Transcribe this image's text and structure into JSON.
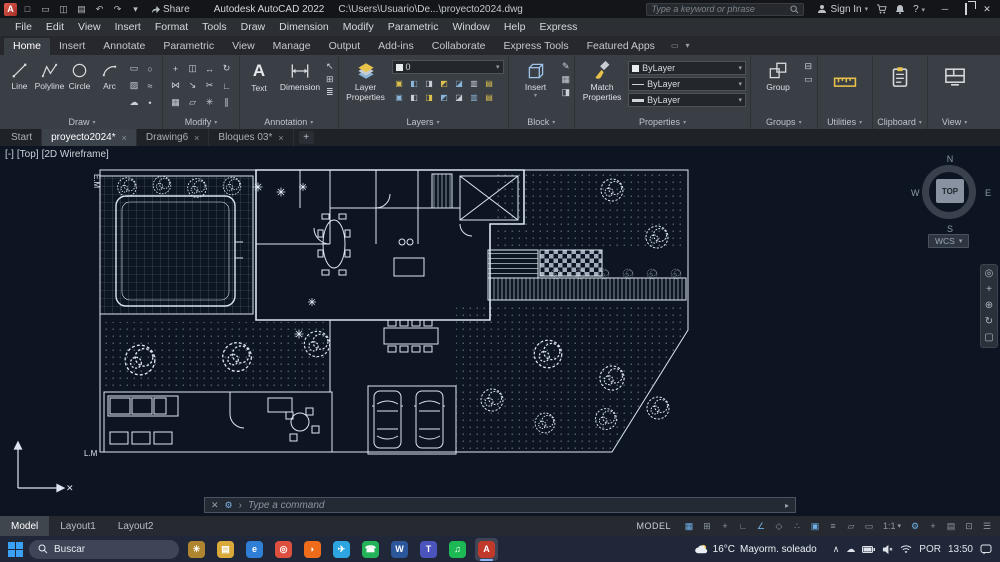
{
  "icons": {
    "caret_down": "▾",
    "minimize": "─",
    "close": "✕",
    "close_small": "×",
    "prompt_arrow": "›",
    "scroll_right": "▸",
    "chevron_up": "∧",
    "cloud": "☁",
    "dock_wrench": "⚙",
    "dock_close": "✕"
  },
  "titlebar": {
    "logo_letter": "A",
    "quick_icons": [
      {
        "name": "new-drawing-icon",
        "glyph": "□"
      },
      {
        "name": "open-icon",
        "glyph": "▭"
      },
      {
        "name": "save-icon",
        "glyph": "◫"
      },
      {
        "name": "plot-icon",
        "glyph": "▤"
      },
      {
        "name": "undo-icon",
        "glyph": "↶"
      },
      {
        "name": "redo-icon",
        "glyph": "↷"
      },
      {
        "name": "quick-access-caret-icon",
        "glyph": "▾"
      }
    ],
    "share_label": "Share",
    "app_title": "Autodesk AutoCAD 2022",
    "doc_path": "C:\\Users\\Usuario\\De...\\proyecto2024.dwg",
    "search_placeholder": "Type a keyword or phrase",
    "sign_in_label": "Sign In",
    "help_label": "?"
  },
  "menubar": {
    "items": [
      "File",
      "Edit",
      "View",
      "Insert",
      "Format",
      "Tools",
      "Draw",
      "Dimension",
      "Modify",
      "Parametric",
      "Window",
      "Help",
      "Express"
    ]
  },
  "ribbon": {
    "tabs": [
      {
        "label": "Home",
        "active": true
      },
      {
        "label": "Insert"
      },
      {
        "label": "Annotate"
      },
      {
        "label": "Parametric"
      },
      {
        "label": "View"
      },
      {
        "label": "Manage"
      },
      {
        "label": "Output"
      },
      {
        "label": "Add-ins"
      },
      {
        "label": "Collaborate"
      },
      {
        "label": "Express Tools"
      },
      {
        "label": "Featured Apps"
      }
    ],
    "draw": {
      "label": "Draw",
      "tools": [
        {
          "name": "line-tool",
          "label": "Line"
        },
        {
          "name": "polyline-tool",
          "label": "Polyline"
        },
        {
          "name": "circle-tool",
          "label": "Circle"
        },
        {
          "name": "arc-tool",
          "label": "Arc"
        }
      ],
      "minis": [
        {
          "name": "rectangle-tool-icon",
          "glyph": "▭"
        },
        {
          "name": "ellipse-tool-icon",
          "glyph": "○"
        },
        {
          "name": "hatch-tool-icon",
          "glyph": "▨"
        },
        {
          "name": "spline-tool-icon",
          "glyph": "≈"
        },
        {
          "name": "revision-cloud-tool-icon",
          "glyph": "☁"
        },
        {
          "name": "point-tool-icon",
          "glyph": "•"
        }
      ]
    },
    "modify": {
      "label": "Modify",
      "tools": [
        {
          "name": "move-tool-icon",
          "glyph": "+"
        },
        {
          "name": "copy-tool-icon",
          "glyph": "◫"
        },
        {
          "name": "stretch-tool-icon",
          "glyph": "↔"
        },
        {
          "name": "rotate-tool-icon",
          "glyph": "↻"
        },
        {
          "name": "mirror-tool-icon",
          "glyph": "⋈"
        },
        {
          "name": "scale-tool-icon",
          "glyph": "↘"
        },
        {
          "name": "trim-tool-icon",
          "glyph": "✂"
        },
        {
          "name": "fillet-tool-icon",
          "glyph": "∟"
        },
        {
          "name": "array-tool-icon",
          "glyph": "▦"
        },
        {
          "name": "erase-tool-icon",
          "glyph": "▱"
        },
        {
          "name": "explode-tool-icon",
          "glyph": "✳"
        },
        {
          "name": "offset-tool-icon",
          "glyph": "∥"
        }
      ]
    },
    "annotation": {
      "label": "Annotation",
      "text_label": "Text",
      "dim_label": "Dimension",
      "minis": [
        {
          "name": "leader-tool-icon",
          "glyph": "↖"
        },
        {
          "name": "table-tool-icon",
          "glyph": "⊞"
        },
        {
          "name": "mtext-tool-icon",
          "glyph": "≣"
        }
      ]
    },
    "layers": {
      "label": "Layers",
      "big_line1": "Layer",
      "big_line2": "Properties",
      "combo_value": "0",
      "minis": [
        {
          "name": "layer-state-icon",
          "glyph": "▣",
          "color": "#dcc24d"
        },
        {
          "name": "layer-isolate-icon",
          "glyph": "◧",
          "color": "#8ab4d8"
        },
        {
          "name": "layer-freeze-icon",
          "glyph": "◨",
          "color": "#c8cdd3"
        },
        {
          "name": "layer-lock-icon",
          "glyph": "◩",
          "color": "#dcc24d"
        },
        {
          "name": "layer-off-icon",
          "glyph": "◪",
          "color": "#8ab4d8"
        },
        {
          "name": "layer-match-icon",
          "glyph": "▥",
          "color": "#c8cdd3"
        },
        {
          "name": "layer-prev-icon",
          "glyph": "▤",
          "color": "#dcc24d"
        },
        {
          "name": "layer-walk-icon",
          "glyph": "▣",
          "color": "#8ab4d8"
        },
        {
          "name": "layer-thaw-icon",
          "glyph": "◧",
          "color": "#c8cdd3"
        },
        {
          "name": "layer-on-icon",
          "glyph": "◨",
          "color": "#dcc24d"
        },
        {
          "name": "layer-merge-icon",
          "glyph": "◩",
          "color": "#8ab4d8"
        },
        {
          "name": "layer-delete-icon",
          "glyph": "◪",
          "color": "#c8cdd3"
        },
        {
          "name": "layer-unlock-icon",
          "glyph": "▥",
          "color": "#8ab4d8"
        },
        {
          "name": "layer-current-icon",
          "glyph": "▤",
          "color": "#dcc24d"
        }
      ]
    },
    "block": {
      "label": "Block",
      "big_label": "Insert",
      "minis": [
        {
          "name": "create-block-icon",
          "glyph": "✎"
        },
        {
          "name": "edit-block-icon",
          "glyph": "▦"
        },
        {
          "name": "block-attributes-icon",
          "glyph": "◨"
        }
      ]
    },
    "properties": {
      "label": "Properties",
      "big_line1": "Match",
      "big_line2": "Properties",
      "combos": [
        {
          "name": "object-color-combo",
          "value": "ByLayer",
          "kind": "swatch"
        },
        {
          "name": "linetype-combo",
          "value": "ByLayer",
          "kind": "line"
        },
        {
          "name": "lineweight-combo",
          "value": "ByLayer",
          "kind": "thick"
        }
      ]
    },
    "groups": {
      "label": "Groups",
      "big_label": "Group",
      "minis": [
        {
          "name": "ungroup-icon",
          "glyph": "⊟"
        },
        {
          "name": "group-edit-icon",
          "glyph": "▭"
        }
      ]
    },
    "utilities": {
      "label": "Utilities"
    },
    "clipboard": {
      "label": "Clipboard"
    },
    "view_panel": {
      "label": "View"
    }
  },
  "filetabs": {
    "tabs": [
      {
        "label": "Start"
      },
      {
        "label": "proyecto2024*",
        "active": true,
        "closable": true
      },
      {
        "label": "Drawing6",
        "closable": true
      },
      {
        "label": "Bloques 03*",
        "closable": true
      }
    ],
    "new_tab_label": "+"
  },
  "viewport": {
    "control_min": "[-]",
    "control_view": "[Top]",
    "control_visual": "[2D Wireframe]",
    "em_label": "E.M",
    "lm_label": "L.M",
    "viewcube": {
      "north": "N",
      "west": "W",
      "south": "S",
      "east": "E",
      "top": "TOP",
      "wcs": "WCS"
    },
    "navbar": [
      {
        "name": "navigation-wheel-icon",
        "glyph": "◎"
      },
      {
        "name": "pan-icon",
        "glyph": "+"
      },
      {
        "name": "zoom-icon",
        "glyph": "⊕"
      },
      {
        "name": "orbit-icon",
        "glyph": "↻"
      },
      {
        "name": "show-motion-icon",
        "glyph": "▢"
      }
    ]
  },
  "command": {
    "placeholder": "Type a command"
  },
  "layouts": {
    "tabs": [
      {
        "label": "Model",
        "active": true
      },
      {
        "label": "Layout1"
      },
      {
        "label": "Layout2"
      }
    ]
  },
  "statusbar": {
    "model_label": "MODEL",
    "toggles": [
      {
        "name": "grid-display-toggle",
        "glyph": "▦",
        "active": true
      },
      {
        "name": "snap-mode-toggle",
        "glyph": "⊞"
      },
      {
        "name": "dynamic-input-toggle",
        "glyph": "+"
      },
      {
        "name": "ortho-mode-toggle",
        "glyph": "∟"
      },
      {
        "name": "polar-tracking-toggle",
        "glyph": "∠",
        "active": true
      },
      {
        "name": "isometric-drafting-toggle",
        "glyph": "◇"
      },
      {
        "name": "osnap-tracking-toggle",
        "glyph": "∴"
      },
      {
        "name": "object-snap-toggle",
        "glyph": "▣",
        "active": true
      },
      {
        "name": "lineweight-toggle",
        "glyph": "≡"
      },
      {
        "name": "transparency-toggle",
        "glyph": "▱"
      },
      {
        "name": "selection-cycling-toggle",
        "glyph": "▭"
      }
    ],
    "scale": "1:1",
    "toggles2": [
      {
        "name": "workspace-gear-icon",
        "glyph": "⚙",
        "active": true
      },
      {
        "name": "annotation-monitor-toggle",
        "glyph": "+"
      },
      {
        "name": "quick-properties-toggle",
        "glyph": "▤"
      },
      {
        "name": "clean-screen-toggle",
        "glyph": "⊡"
      },
      {
        "name": "customize-status-icon",
        "glyph": "☰"
      }
    ]
  },
  "taskbar": {
    "search_placeholder": "Buscar",
    "apps": [
      {
        "name": "widget-gold-icon",
        "glyph": "✳",
        "color": "#b08530"
      },
      {
        "name": "file-explorer-icon",
        "glyph": "▤",
        "color": "#d9a93a"
      },
      {
        "name": "edge-icon",
        "glyph": "e",
        "color": "#2f7fd6"
      },
      {
        "name": "chrome-icon",
        "glyph": "◎",
        "color": "#dd4f3e"
      },
      {
        "name": "firefox-icon",
        "glyph": "◗",
        "color": "#ef6c1a"
      },
      {
        "name": "telegram-icon",
        "glyph": "✈",
        "color": "#2ca5e0"
      },
      {
        "name": "whatsapp-icon",
        "glyph": "☎",
        "color": "#25b35a"
      },
      {
        "name": "word-icon",
        "glyph": "W",
        "color": "#2b579a"
      },
      {
        "name": "teams-icon",
        "glyph": "T",
        "color": "#4b53bc"
      },
      {
        "name": "spotify-icon",
        "glyph": "♫",
        "color": "#1db954"
      },
      {
        "name": "autocad-icon",
        "glyph": "A",
        "color": "#c0392b",
        "active": true
      }
    ],
    "weather": {
      "temp": "16°C",
      "desc": "Mayorm. soleado"
    },
    "tray_lang": "POR",
    "tray_time": "13:50"
  }
}
